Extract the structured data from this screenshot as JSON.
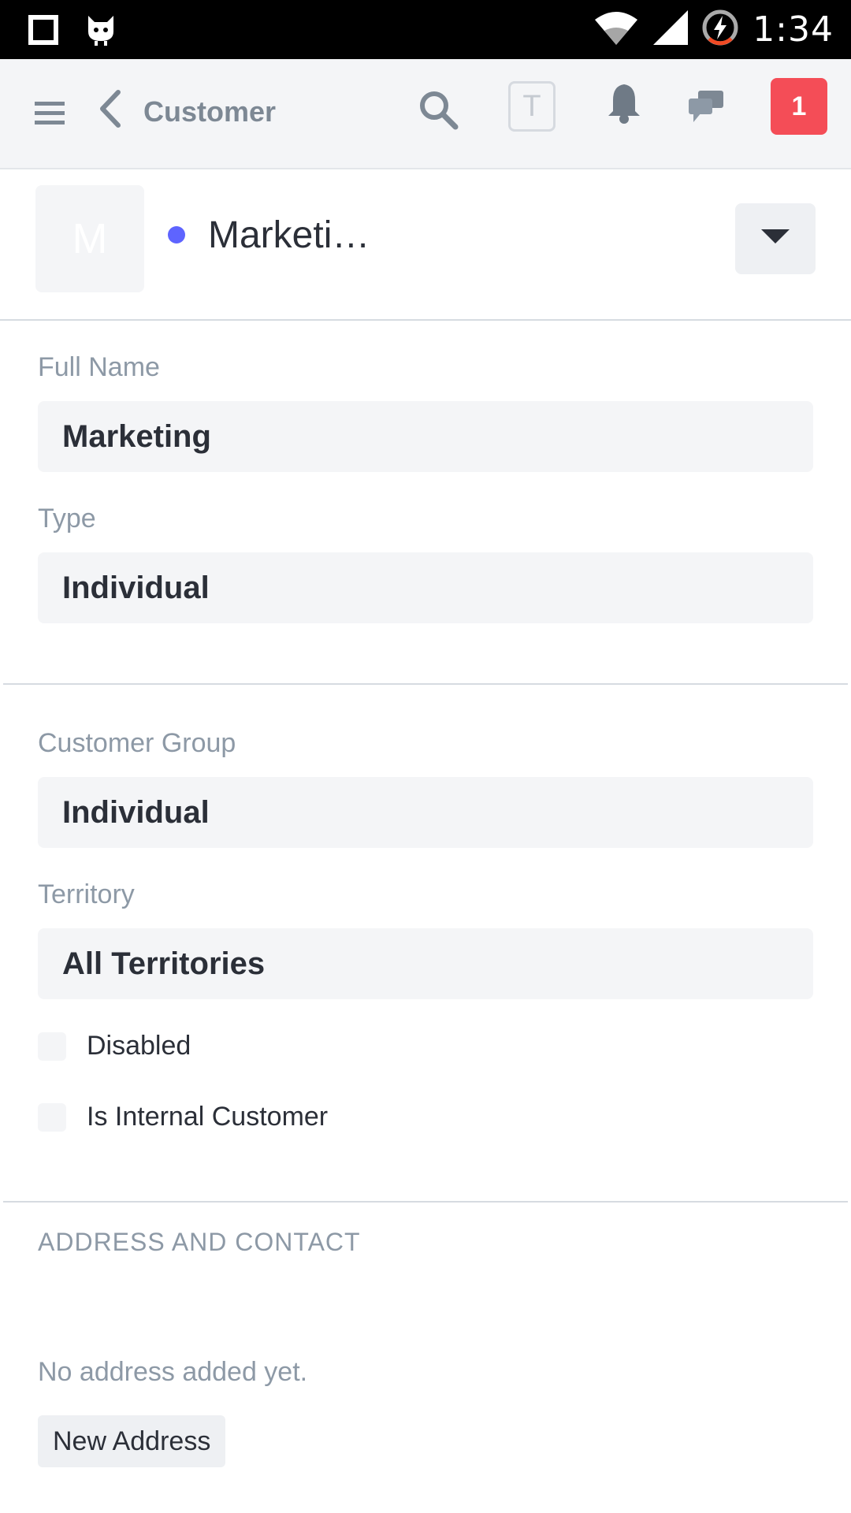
{
  "status_bar": {
    "time": "1:34",
    "icons": [
      "square-notification-icon",
      "cat-notification-icon",
      "wifi-icon",
      "signal-icon",
      "battery-charging-icon"
    ]
  },
  "app_bar": {
    "title": "Customer",
    "avatar_initial": "T",
    "notification_count": "1",
    "icons": [
      "menu-icon",
      "back-chevron-icon",
      "search-icon",
      "bell-icon",
      "chat-icon"
    ]
  },
  "doc_header": {
    "image_initial": "M",
    "name": "Marketi…",
    "status_color": "#5e64ff"
  },
  "form": {
    "full_name": {
      "label": "Full Name",
      "value": "Marketing"
    },
    "type": {
      "label": "Type",
      "value": "Individual"
    },
    "customer_group": {
      "label": "Customer Group",
      "value": "Individual"
    },
    "territory": {
      "label": "Territory",
      "value": "All Territories"
    },
    "disabled": {
      "label": "Disabled",
      "checked": false
    },
    "is_internal_customer": {
      "label": "Is Internal Customer",
      "checked": false
    }
  },
  "address_section": {
    "title": "ADDRESS AND CONTACT",
    "empty_text": "No address added yet.",
    "new_address_label": "New Address"
  },
  "colors": {
    "badge": "#f44d57",
    "accent_dot": "#5e64ff",
    "label_gray": "#8d99a6",
    "field_bg": "#f4f5f7"
  }
}
